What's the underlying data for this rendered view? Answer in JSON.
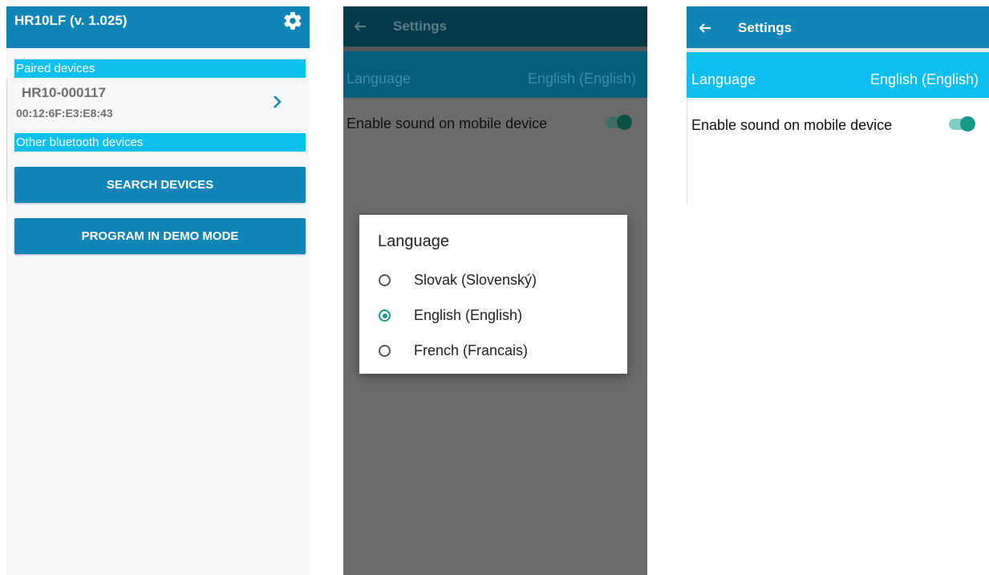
{
  "screen1": {
    "title": "HR10LF (v. 1.025)",
    "settings_icon": "gear-icon",
    "paired_header": "Paired devices",
    "paired_device": {
      "name": "HR10-000117",
      "mac": "00:12:6F:E3:E8:43",
      "icon": "chevron-right-icon"
    },
    "other_header": "Other bluetooth devices",
    "search_button": "SEARCH DEVICES",
    "demo_button": "PROGRAM IN DEMO MODE"
  },
  "screen2": {
    "title": "Settings",
    "back_icon": "arrow-left-icon",
    "language_label": "Language",
    "language_value": "English (English)",
    "sound_label": "Enable sound on mobile device",
    "dialog": {
      "title": "Language",
      "options": [
        {
          "label": "Slovak (Slovenský)",
          "selected": false
        },
        {
          "label": "English (English)",
          "selected": true
        },
        {
          "label": "French (Francais)",
          "selected": false
        }
      ]
    }
  },
  "screen3": {
    "title": "Settings",
    "back_icon": "arrow-left-icon",
    "language_label": "Language",
    "language_value": "English (English)",
    "sound_label": "Enable sound on mobile device",
    "sound_enabled": true
  },
  "colors": {
    "primary": "#1184b8",
    "section": "#0fc0ef",
    "accent": "#17988a"
  }
}
